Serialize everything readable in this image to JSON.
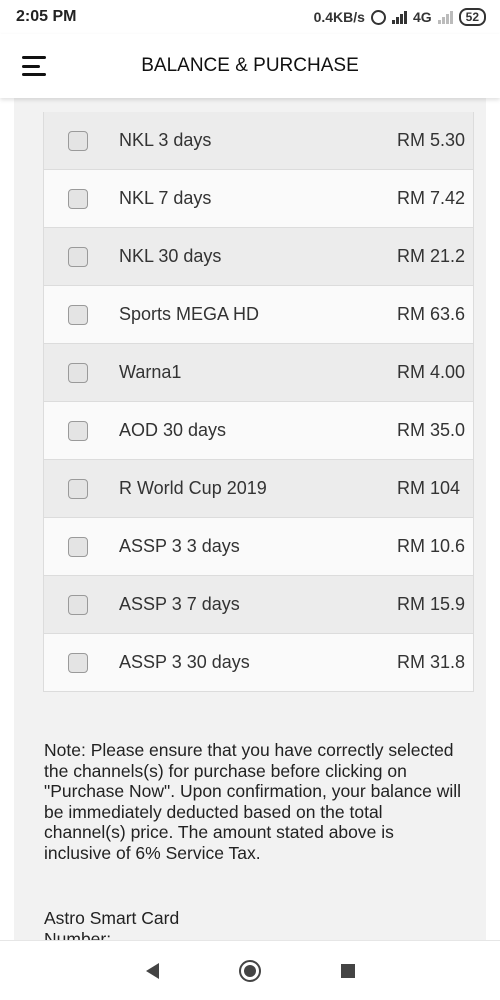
{
  "status_bar": {
    "time": "2:05 PM",
    "network_speed": "0.4KB/s",
    "network_type": "4G",
    "battery": "52"
  },
  "header": {
    "title": "BALANCE & PURCHASE"
  },
  "channels": [
    {
      "name": "NKL 3 days",
      "price": "RM 5.30",
      "checked": false
    },
    {
      "name": "NKL 7 days",
      "price": "RM 7.42",
      "checked": false
    },
    {
      "name": "NKL 30 days",
      "price": "RM 21.2",
      "checked": false
    },
    {
      "name": "Sports MEGA HD",
      "price": "RM 63.6",
      "checked": false
    },
    {
      "name": "Warna1",
      "price": "RM 4.00",
      "checked": false
    },
    {
      "name": "AOD 30 days",
      "price": "RM 35.0",
      "checked": false
    },
    {
      "name": "R World Cup 2019",
      "price": "RM 104",
      "checked": false
    },
    {
      "name": "ASSP 3 3 days",
      "price": "RM 10.6",
      "checked": false
    },
    {
      "name": "ASSP 3 7 days",
      "price": "RM 15.9",
      "checked": false
    },
    {
      "name": "ASSP 3 30 days",
      "price": "RM 31.8",
      "checked": false
    }
  ],
  "note": "Note: Please ensure that you have correctly selected the channels(s) for purchase before clicking on \"Purchase Now\". Upon confirmation, your balance will be immediately deducted based on the total channel(s) price. The amount stated above is inclusive of 6% Service Tax.",
  "smart_card_label": "Astro Smart Card Number:",
  "icons": {
    "menu": "hamburger-menu-icon",
    "alarm": "alarm-clock-icon",
    "back": "back-triangle-icon",
    "home": "home-circle-icon",
    "recents": "recents-square-icon"
  }
}
